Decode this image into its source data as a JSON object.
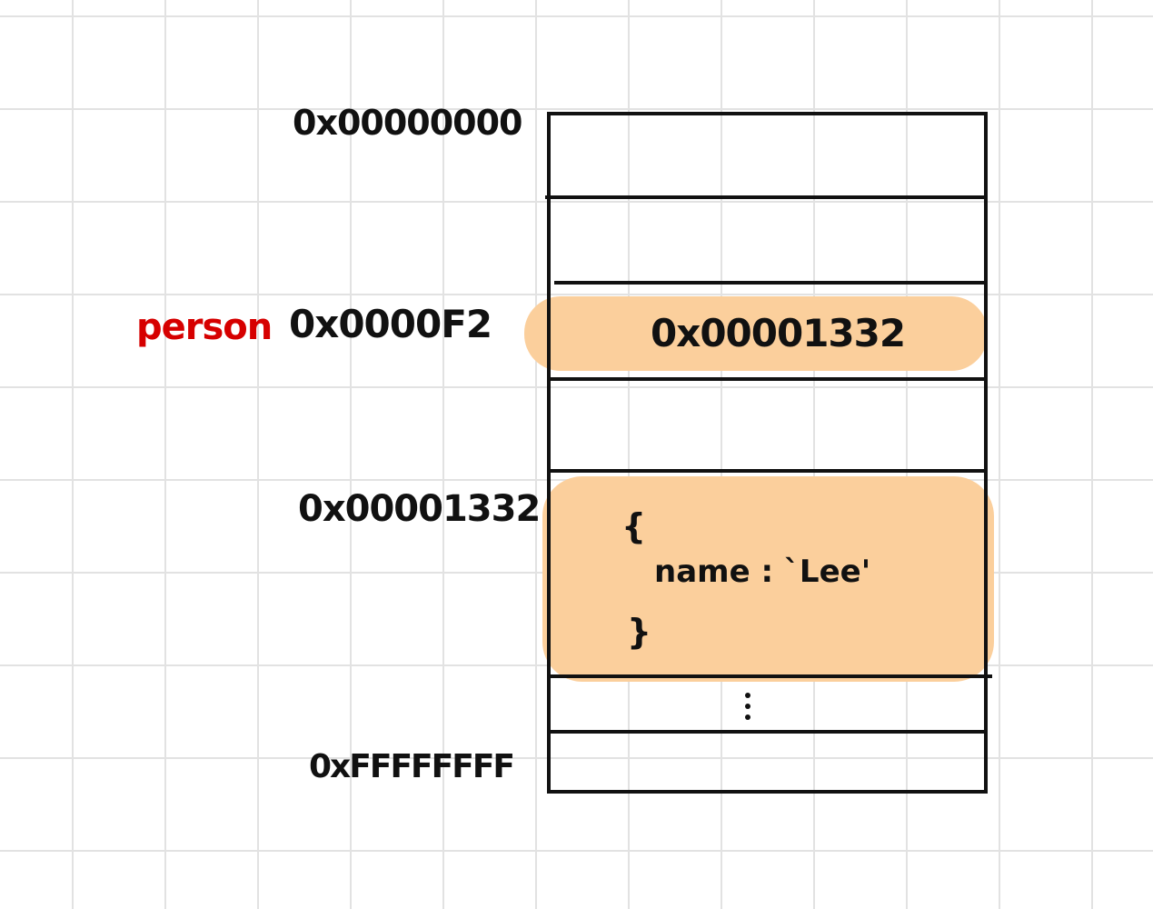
{
  "address_labels": {
    "start": "0x00000000",
    "person_addr": "0x0000F2",
    "object_addr": "0x00001332",
    "end": "0xFFFFFFFF"
  },
  "variable_label": "person",
  "cells": {
    "person_value": "0x00001332",
    "object_open": "{",
    "object_body": "name : `Lee'",
    "object_close": "}"
  },
  "colors": {
    "highlight": "#fbcf9c",
    "variable": "#d60000",
    "ink": "#111111",
    "grid": "#e2e2e2"
  }
}
